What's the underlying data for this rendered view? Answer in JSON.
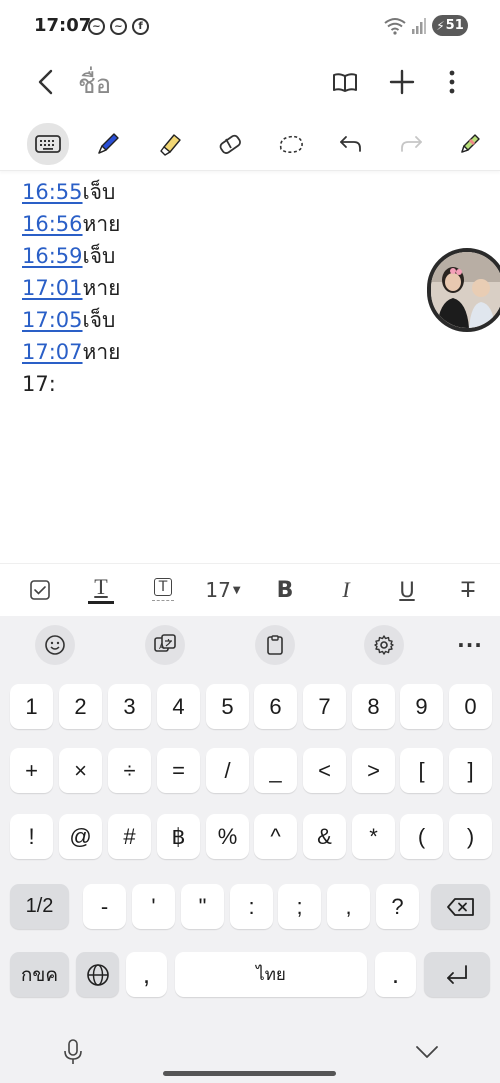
{
  "status_bar": {
    "time": "17:07",
    "battery_level": "51",
    "notification_icons": [
      "messenger-icon",
      "messenger-icon",
      "facebook-icon"
    ]
  },
  "header": {
    "title": "ชื่อ",
    "icons": [
      "back-icon",
      "book-icon",
      "plus-icon",
      "more-vertical-icon"
    ]
  },
  "drawing_toolbar": {
    "tools": [
      "keyboard-icon",
      "pen-icon",
      "highlighter-icon",
      "eraser-icon",
      "lasso-icon",
      "undo-icon",
      "redo-icon",
      "pen-settings-icon"
    ],
    "active_tool": "keyboard-icon",
    "colors": {
      "pen": "#2a4fd6",
      "highlighter": "#f2d774",
      "active_bg": "#e4e4e4"
    }
  },
  "note": {
    "lines": [
      {
        "time": "16:55",
        "word": "เจ็บ"
      },
      {
        "time": "16:56",
        "word": "หาย"
      },
      {
        "time": "16:59",
        "word": "เจ็บ"
      },
      {
        "time": "17:01",
        "word": "หาย"
      },
      {
        "time": "17:05",
        "word": "เจ็บ"
      },
      {
        "time": "17:07",
        "word": "หาย"
      }
    ],
    "current_input": "17:",
    "link_color": "#2a5fc7"
  },
  "format_bar": {
    "font_size": "17",
    "bold_label": "B",
    "italic_label": "I",
    "underline_label": "U",
    "strike_label": "T",
    "text_color_label": "T",
    "text_bg_label": "T"
  },
  "keyboard": {
    "toolbar_icons": [
      "emoji-icon",
      "translate-icon",
      "clipboard-icon",
      "settings-icon",
      "more-icon"
    ],
    "more_label": "···",
    "rows": [
      [
        "1",
        "2",
        "3",
        "4",
        "5",
        "6",
        "7",
        "8",
        "9",
        "0"
      ],
      [
        "+",
        "×",
        "÷",
        "=",
        "/",
        "_",
        "<",
        ">",
        "[",
        "]"
      ],
      [
        "!",
        "@",
        "#",
        "฿",
        "%",
        "^",
        "&",
        "*",
        "(",
        ")"
      ],
      [
        "-",
        "'",
        "\"",
        ":",
        ";",
        ",",
        "?"
      ]
    ],
    "page_key": "1/2",
    "lang_key": "กขค",
    "comma_key": ",",
    "space_label": "ไทย",
    "period_key": "."
  }
}
